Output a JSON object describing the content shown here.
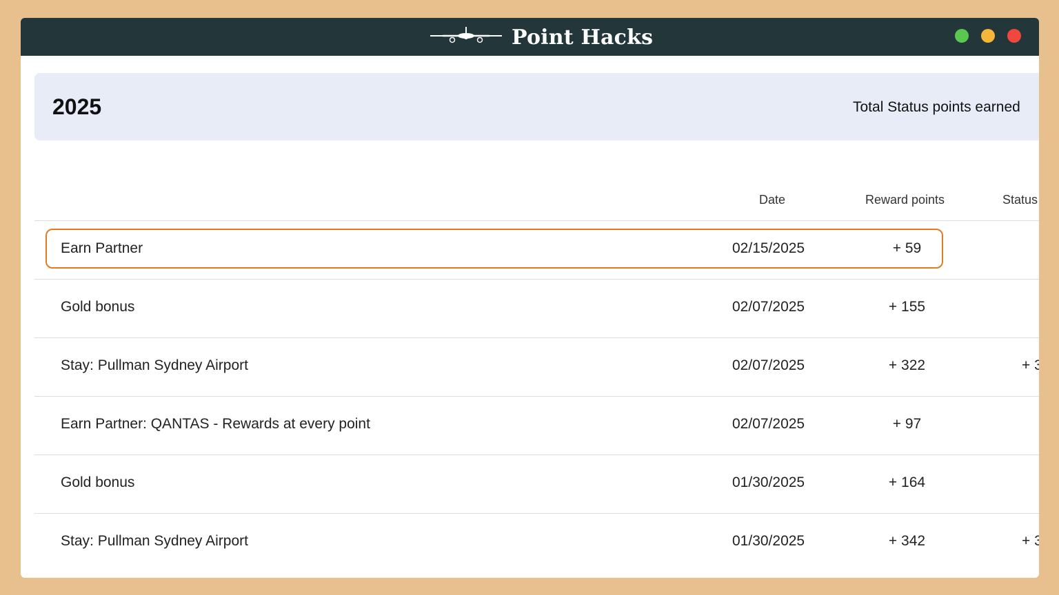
{
  "app": {
    "brand_name": "Point Hacks",
    "logo_icon": "airplane-icon"
  },
  "window_controls": {
    "colors": [
      "#5ac84e",
      "#f5b73a",
      "#f0483e"
    ]
  },
  "summary": {
    "year": "2025",
    "status_total_label": "Total Status points earned"
  },
  "table": {
    "headers": {
      "date": "Date",
      "reward": "Reward points",
      "status": "Status"
    },
    "rows": [
      {
        "description": "Earn Partner",
        "date": "02/15/2025",
        "reward": "+ 59",
        "status": ""
      },
      {
        "description": "Gold bonus",
        "date": "02/07/2025",
        "reward": "+ 155",
        "status": ""
      },
      {
        "description": "Stay: Pullman Sydney Airport",
        "date": "02/07/2025",
        "reward": "+ 322",
        "status": "+ 3"
      },
      {
        "description": "Earn Partner: QANTAS - Rewards at every point",
        "date": "02/07/2025",
        "reward": "+ 97",
        "status": ""
      },
      {
        "description": "Gold bonus",
        "date": "01/30/2025",
        "reward": "+ 164",
        "status": ""
      },
      {
        "description": "Stay: Pullman Sydney Airport",
        "date": "01/30/2025",
        "reward": "+ 342",
        "status": "+ 3"
      }
    ],
    "highlight_color": "#e07b20"
  }
}
